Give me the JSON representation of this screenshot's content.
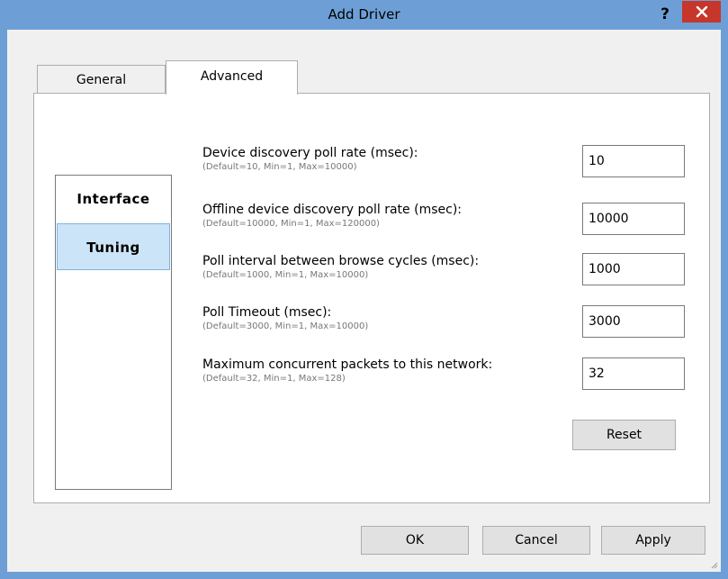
{
  "window": {
    "title": "Add Driver",
    "help_label": "?"
  },
  "tabs": [
    {
      "label": "General",
      "selected": false
    },
    {
      "label": "Advanced",
      "selected": true
    }
  ],
  "sidebar": {
    "items": [
      {
        "label": "Interface",
        "selected": false
      },
      {
        "label": "Tuning",
        "selected": true
      }
    ]
  },
  "settings": [
    {
      "label": "Device discovery poll rate (msec):",
      "hint": "(Default=10, Min=1, Max=10000)",
      "value": "10"
    },
    {
      "label": "Offline device discovery poll rate (msec):",
      "hint": "(Default=10000, Min=1, Max=120000)",
      "value": "10000"
    },
    {
      "label": "Poll interval between browse cycles (msec):",
      "hint": "(Default=1000, Min=1, Max=10000)",
      "value": "1000"
    },
    {
      "label": "Poll Timeout (msec):",
      "hint": "(Default=3000, Min=1, Max=10000)",
      "value": "3000"
    },
    {
      "label": "Maximum concurrent packets to this network:",
      "hint": "(Default=32, Min=1, Max=128)",
      "value": "32"
    }
  ],
  "buttons": {
    "reset": "Reset",
    "ok": "OK",
    "cancel": "Cancel",
    "apply": "Apply"
  },
  "colors": {
    "title_bar": "#6d9fd6",
    "close_button": "#c7362a",
    "selected_nav": "#cce4f7"
  }
}
